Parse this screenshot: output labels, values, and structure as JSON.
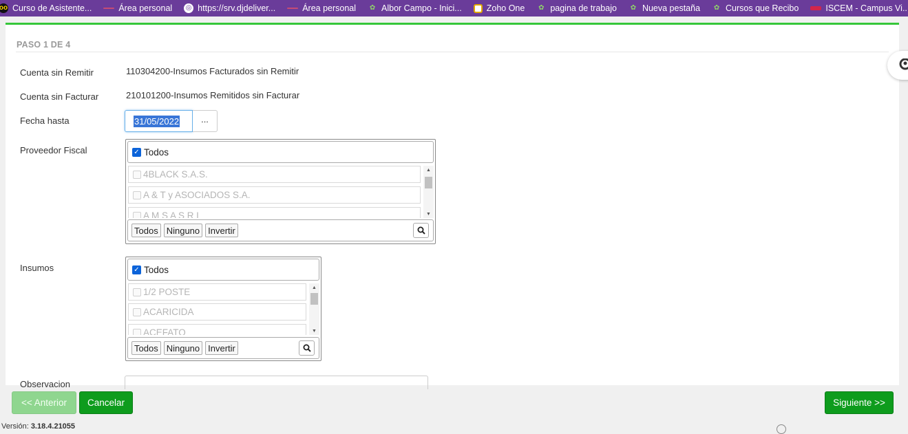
{
  "bookmarks": [
    {
      "label": "Curso de Asistente...",
      "icon": "owl-icon"
    },
    {
      "label": "Área personal",
      "icon": "line-icon"
    },
    {
      "label": "https://srv.djdeliver...",
      "icon": "globe-icon"
    },
    {
      "label": "Área personal",
      "icon": "line-icon"
    },
    {
      "label": "Albor Campo - Inici...",
      "icon": "sprout-icon"
    },
    {
      "label": "Zoho One",
      "icon": "zoho-icon"
    },
    {
      "label": "pagina de trabajo",
      "icon": "sprout-icon"
    },
    {
      "label": "Nueva pestaña",
      "icon": "sprout-icon"
    },
    {
      "label": "Cursos que Recibo",
      "icon": "sprout-icon"
    },
    {
      "label": "ISCEM - Campus Vi...",
      "icon": "iscem-icon"
    }
  ],
  "step": {
    "title": "PASO 1 DE 4"
  },
  "form": {
    "cuenta_sin_remitir": {
      "label": "Cuenta sin Remitir",
      "value": "110304200-Insumos Facturados sin Remitir"
    },
    "cuenta_sin_facturar": {
      "label": "Cuenta sin Facturar",
      "value": "210101200-Insumos Remitidos sin Facturar"
    },
    "fecha_hasta": {
      "label": "Fecha hasta",
      "value": "31/05/2022",
      "button": "..."
    },
    "proveedor_fiscal": {
      "label": "Proveedor Fiscal",
      "all_label": "Todos",
      "items": [
        "4BLACK S.A.S.",
        "A & T y ASOCIADOS S.A.",
        "A M S A S R L"
      ],
      "buttons": {
        "all": "Todos",
        "none": "Ninguno",
        "invert": "Invertir"
      }
    },
    "insumos": {
      "label": "Insumos",
      "all_label": "Todos",
      "items": [
        "1/2 POSTE",
        "ACARICIDA",
        "ACEFATO"
      ],
      "buttons": {
        "all": "Todos",
        "none": "Ninguno",
        "invert": "Invertir"
      }
    },
    "observacion": {
      "label": "Observacion"
    }
  },
  "actions": {
    "prev": "<< Anterior",
    "cancel": "Cancelar",
    "next": "Siguiente >>"
  },
  "footer": {
    "version_label": "Versión:",
    "version_value": "3.18.4.21055"
  },
  "colors": {
    "accent_green": "#0e9c1d",
    "top_border": "#36c73a",
    "bookmark_bar": "#6a3c9a"
  }
}
